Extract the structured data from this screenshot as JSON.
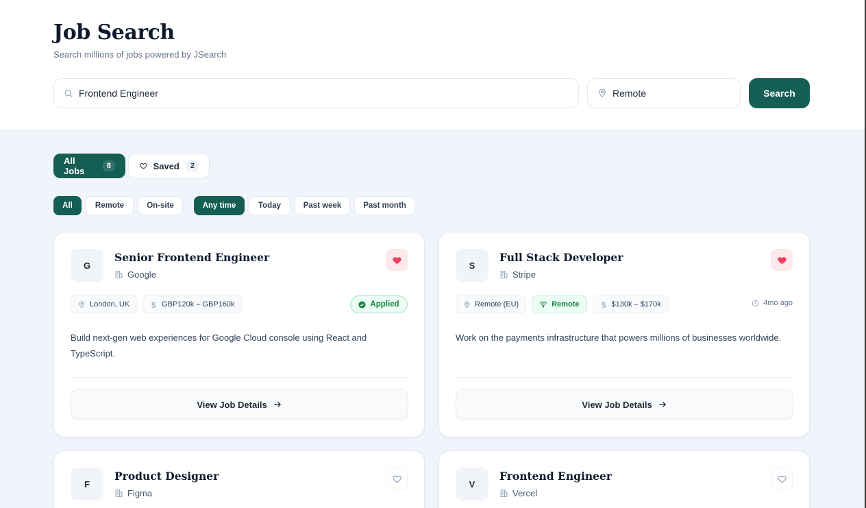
{
  "header": {
    "title": "Job Search",
    "subtitle": "Search millions of jobs powered by JSearch",
    "search_value": "Frontend Engineer",
    "location_value": "Remote",
    "search_button": "Search"
  },
  "tabs": [
    {
      "label": "All Jobs",
      "count": "8",
      "active": true
    },
    {
      "label": "Saved",
      "count": "2",
      "active": false
    }
  ],
  "filters": {
    "work_type": [
      "All",
      "Remote",
      "On-site"
    ],
    "work_type_active": "All",
    "date_posted": [
      "Any time",
      "Today",
      "Past week",
      "Past month"
    ],
    "date_posted_active": "Any time"
  },
  "jobs": [
    {
      "initial": "G",
      "title": "Senior Frontend Engineer",
      "company": "Google",
      "saved": true,
      "location": "London, UK",
      "salary": "GBP120k – GBP160k",
      "status": "Applied",
      "description": "Build next-gen web experiences for Google Cloud console using React and TypeScript.",
      "button": "View Job Details"
    },
    {
      "initial": "S",
      "title": "Full Stack Developer",
      "company": "Stripe",
      "saved": true,
      "location": "Remote (EU)",
      "remote": "Remote",
      "salary": "$130k – $170k",
      "posted": "4mo ago",
      "description": "Work on the payments infrastructure that powers millions of businesses worldwide.",
      "button": "View Job Details"
    },
    {
      "initial": "F",
      "title": "Product Designer",
      "company": "Figma",
      "saved": false
    },
    {
      "initial": "V",
      "title": "Frontend Engineer",
      "company": "Vercel",
      "saved": false
    }
  ],
  "colors": {
    "accent": "#155e54",
    "heart": "#f43f5e",
    "applied": "#15803d",
    "background": "#f0f5fb"
  }
}
